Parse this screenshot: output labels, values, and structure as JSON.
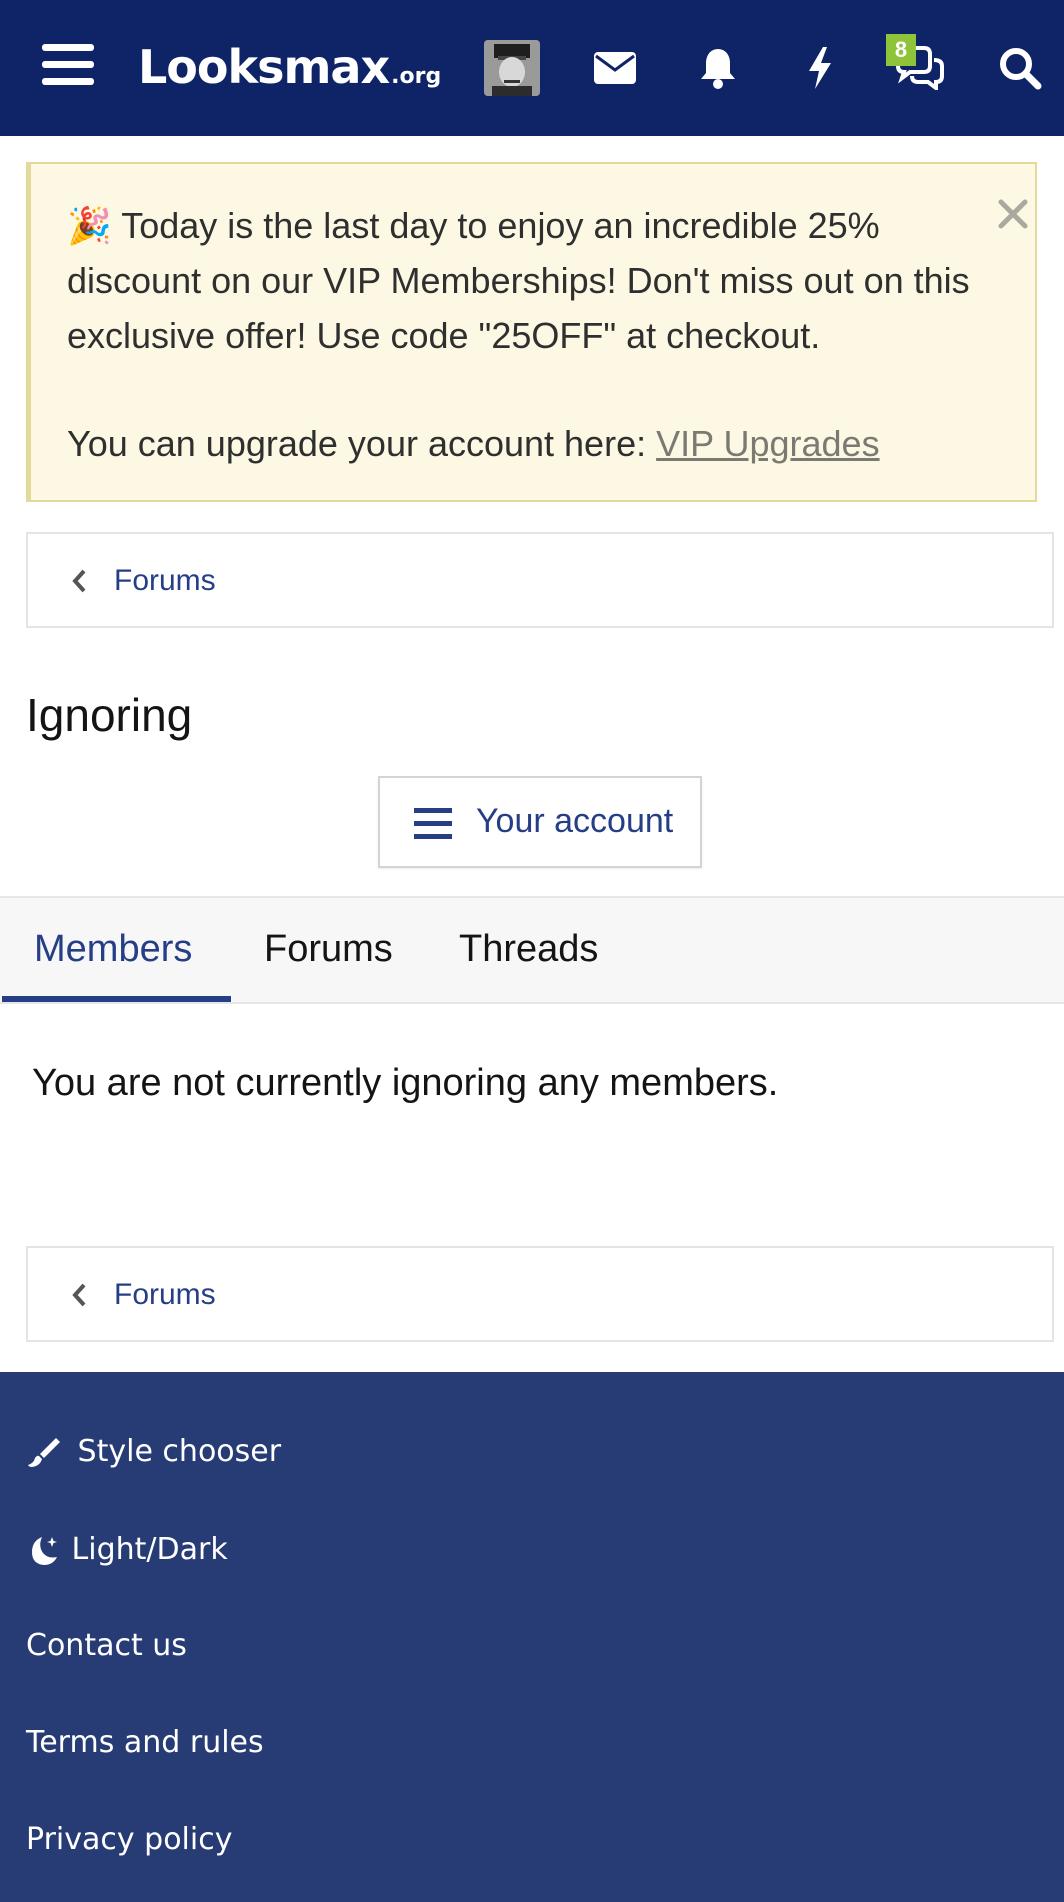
{
  "header": {
    "logo_main": "Looksmax",
    "logo_tld": ".org",
    "icons": [
      "menu-icon",
      "avatar",
      "envelope-icon",
      "bell-icon",
      "lightning-icon",
      "chat-icon",
      "search-icon"
    ],
    "chat_badge_count": "8",
    "bg_color": "#0f2466",
    "badge_color": "#8fc43a"
  },
  "notice": {
    "emoji": "🎉",
    "text": "Today is the last day to enjoy an incredible 25% discount on our VIP Memberships! Don't miss out on this exclusive offer! Use code \"25OFF\" at checkout.",
    "upgrade_prefix": "You can upgrade your account here: ",
    "upgrade_link": "VIP Upgrades",
    "bg_color": "#fcf8e3"
  },
  "breadcrumb": {
    "label": "Forums"
  },
  "page": {
    "title": "Ignoring",
    "account_button": "Your account"
  },
  "tabs": [
    {
      "label": "Members",
      "active": true
    },
    {
      "label": "Forums",
      "active": false
    },
    {
      "label": "Threads",
      "active": false
    }
  ],
  "content": {
    "empty_message": "You are not currently ignoring any members."
  },
  "footer": {
    "links": [
      "Style chooser",
      "Light/Dark",
      "Contact us",
      "Terms and rules",
      "Privacy policy"
    ],
    "bg_color": "#273b75",
    "accent_color": "#253e86"
  }
}
